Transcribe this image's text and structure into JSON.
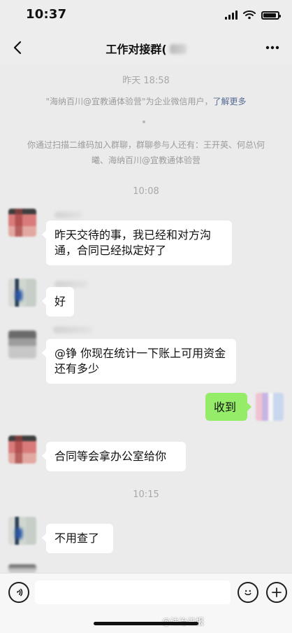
{
  "status_bar": {
    "time": "10:37",
    "battery_level": 0.8
  },
  "nav": {
    "title": "工作对接群(",
    "back_icon": "chevron-left-icon",
    "more_icon": "more-horizontal-icon"
  },
  "chat": {
    "timestamp_1": "昨天 18:58",
    "system_1_text": "\"海纳百川@宜教通体验营\"为企业微信用户，",
    "system_1_link": "了解更多",
    "system_2_text": "你通过扫描二维码加入群聊，群聊参与人还有：王开英、何总\\何曦、海纳百川@宜教通体验营",
    "timestamp_2": "10:08",
    "msg_1": "昨天交待的事，我已经和对方沟通，合同已经拟定好了",
    "msg_2": "好",
    "msg_3": "@铮 你现在统计一下账上可用资金还有多少",
    "msg_4": "收到",
    "msg_5": "合同等会拿办公室给你",
    "timestamp_3": "10:15",
    "msg_6": "不用查了"
  },
  "input_bar": {
    "voice_icon": "voice-icon",
    "emoji_icon": "emoji-icon",
    "plus_icon": "plus-icon",
    "placeholder": ""
  },
  "watermark": "@法治日报"
}
